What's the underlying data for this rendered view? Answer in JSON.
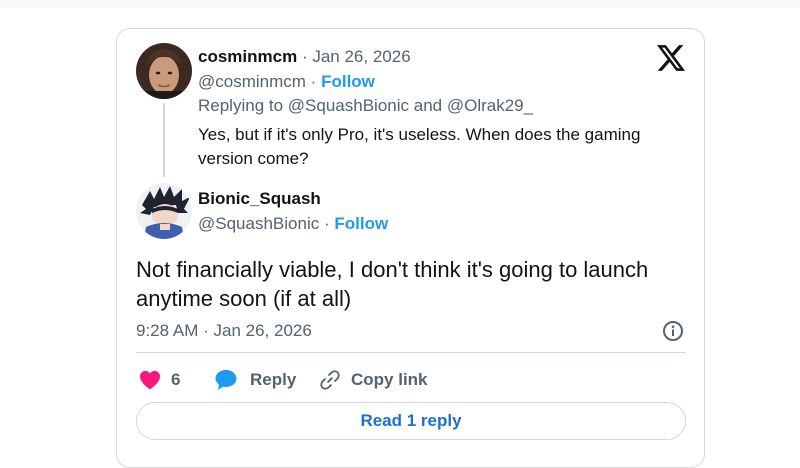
{
  "parent_tweet": {
    "display_name": "cosminmcm",
    "date": "Jan 26, 2026",
    "handle": "@cosminmcm",
    "follow_label": "Follow",
    "replying_prefix": "Replying to",
    "replying_to_1": "@SquashBionic",
    "replying_and": "and",
    "replying_to_2": "@Olrak29_",
    "text": "Yes, but if it's only Pro, it's useless. When does the gaming version come?"
  },
  "main_tweet": {
    "display_name": "Bionic_Squash",
    "handle": "@SquashBionic",
    "follow_label": "Follow",
    "text": "Not financially viable, I don't think it's going to launch anytime soon (if at all)",
    "time": "9:28 AM",
    "date": "Jan 26, 2026"
  },
  "actions": {
    "like_count": "6",
    "reply_label": "Reply",
    "copy_link_label": "Copy link"
  },
  "read_replies_label": "Read 1 reply",
  "separator": "·",
  "icons": {
    "logo": "x-logo-icon",
    "info": "info-icon",
    "like": "heart-icon",
    "reply": "speech-bubble-icon",
    "copy": "link-icon"
  },
  "colors": {
    "accent": "#1d9bf0",
    "like": "#f91880",
    "muted": "#536471",
    "border": "#cfd9de"
  }
}
